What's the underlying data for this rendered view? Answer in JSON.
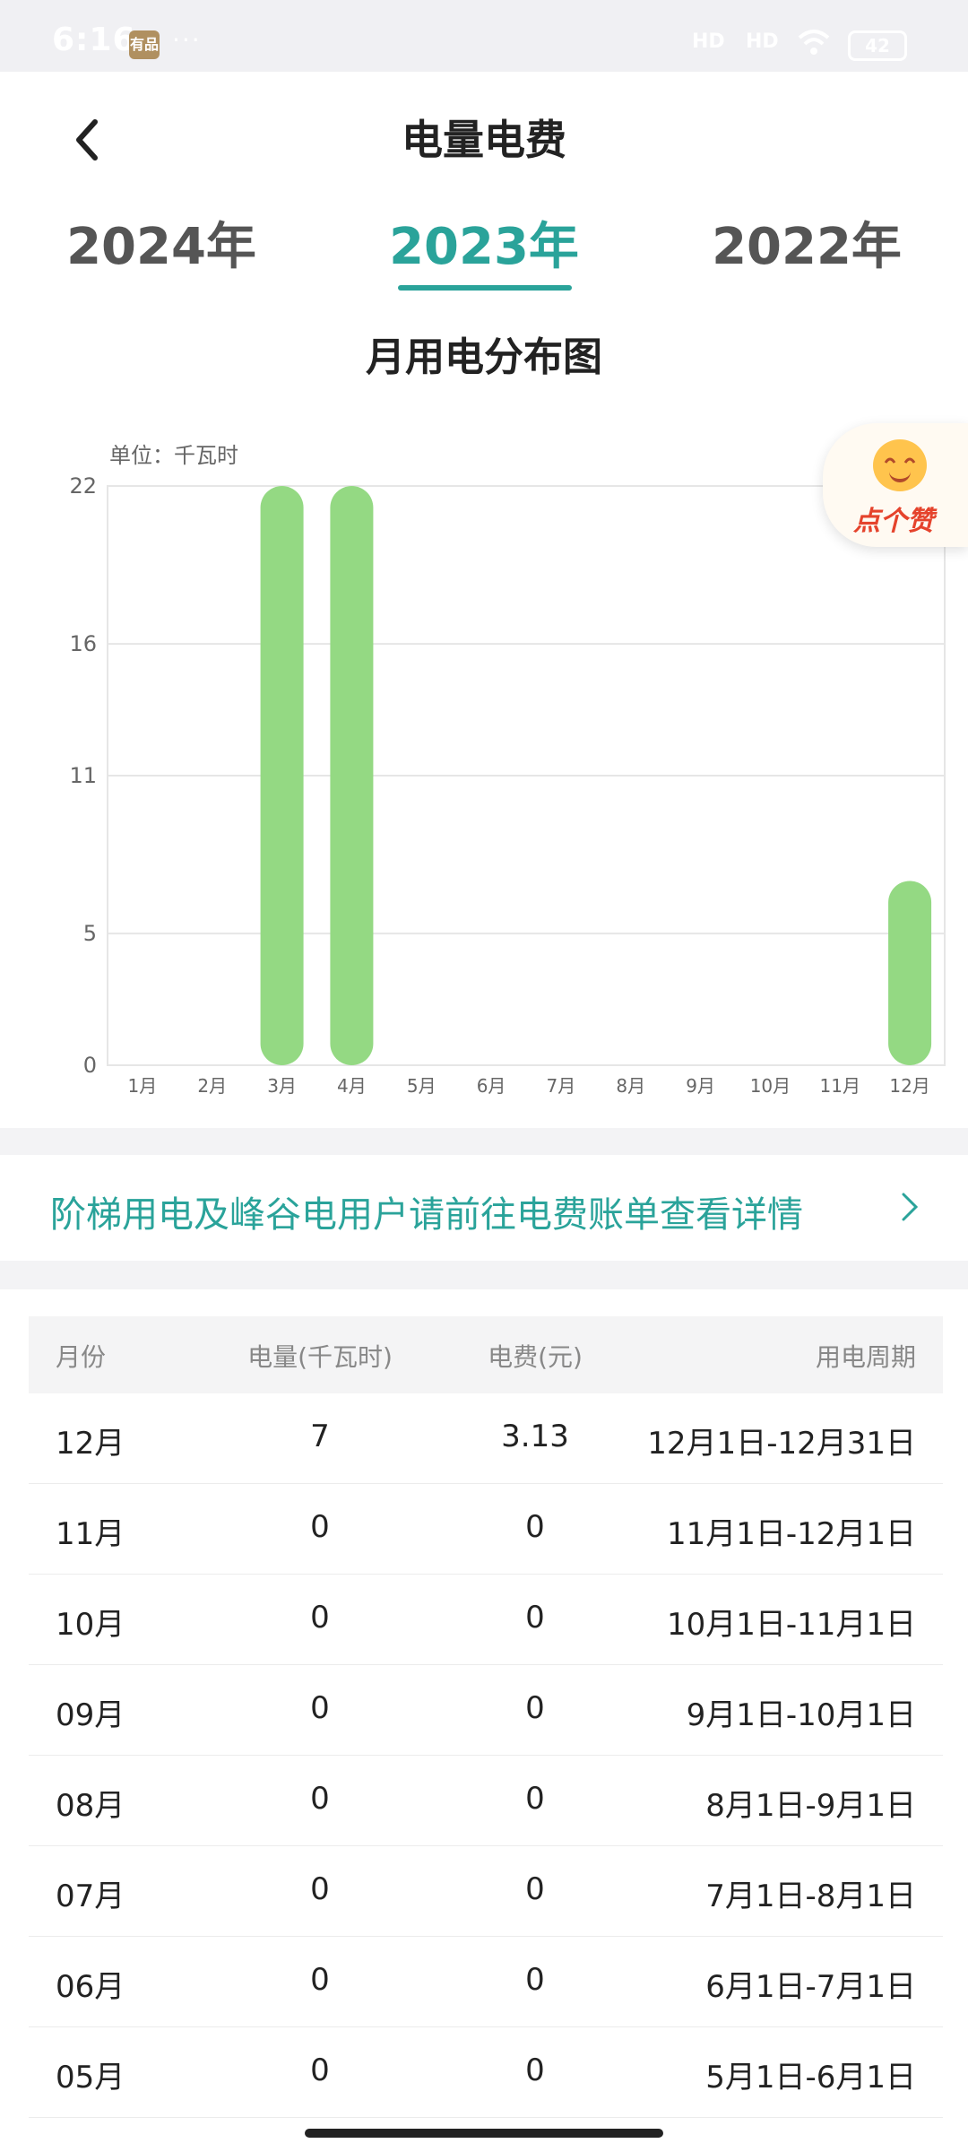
{
  "status_bar": {
    "time": "6:16",
    "app_badge": "有品",
    "dots": "···",
    "signal1": "HD",
    "signal2": "HD",
    "battery": "42"
  },
  "header": {
    "title": "电量电费"
  },
  "year_tabs": [
    {
      "label": "2024年",
      "active": false
    },
    {
      "label": "2023年",
      "active": true
    },
    {
      "label": "2022年",
      "active": false
    }
  ],
  "chart_section": {
    "title": "月用电分布图",
    "unit": "单位：千瓦时"
  },
  "like_button": {
    "label": "点个赞",
    "icon": "smiley-icon"
  },
  "chart_data": {
    "type": "bar",
    "categories": [
      "1月",
      "2月",
      "3月",
      "4月",
      "5月",
      "6月",
      "7月",
      "8月",
      "9月",
      "10月",
      "11月",
      "12月"
    ],
    "values": [
      0,
      0,
      22,
      22,
      0,
      0,
      0,
      0,
      0,
      0,
      0,
      7
    ],
    "y_ticks": [
      0,
      5,
      11,
      16,
      22
    ],
    "ylim": [
      0,
      22
    ],
    "bar_color": "#94d983",
    "grid": true
  },
  "notice": {
    "text": "阶梯用电及峰谷电用户请前往电费账单查看详情"
  },
  "table": {
    "headers": {
      "month": "月份",
      "kwh": "电量(千瓦时)",
      "fee": "电费(元)",
      "period": "用电周期"
    },
    "rows": [
      {
        "month": "12月",
        "kwh": "7",
        "fee": "3.13",
        "period": "12月1日-12月31日"
      },
      {
        "month": "11月",
        "kwh": "0",
        "fee": "0",
        "period": "11月1日-12月1日"
      },
      {
        "month": "10月",
        "kwh": "0",
        "fee": "0",
        "period": "10月1日-11月1日"
      },
      {
        "month": "09月",
        "kwh": "0",
        "fee": "0",
        "period": "9月1日-10月1日"
      },
      {
        "month": "08月",
        "kwh": "0",
        "fee": "0",
        "period": "8月1日-9月1日"
      },
      {
        "month": "07月",
        "kwh": "0",
        "fee": "0",
        "period": "7月1日-8月1日"
      },
      {
        "month": "06月",
        "kwh": "0",
        "fee": "0",
        "period": "6月1日-7月1日"
      },
      {
        "month": "05月",
        "kwh": "0",
        "fee": "0",
        "period": "5月1日-6月1日"
      }
    ]
  },
  "colors": {
    "accent": "#2aa39a",
    "bar": "#94d983"
  }
}
